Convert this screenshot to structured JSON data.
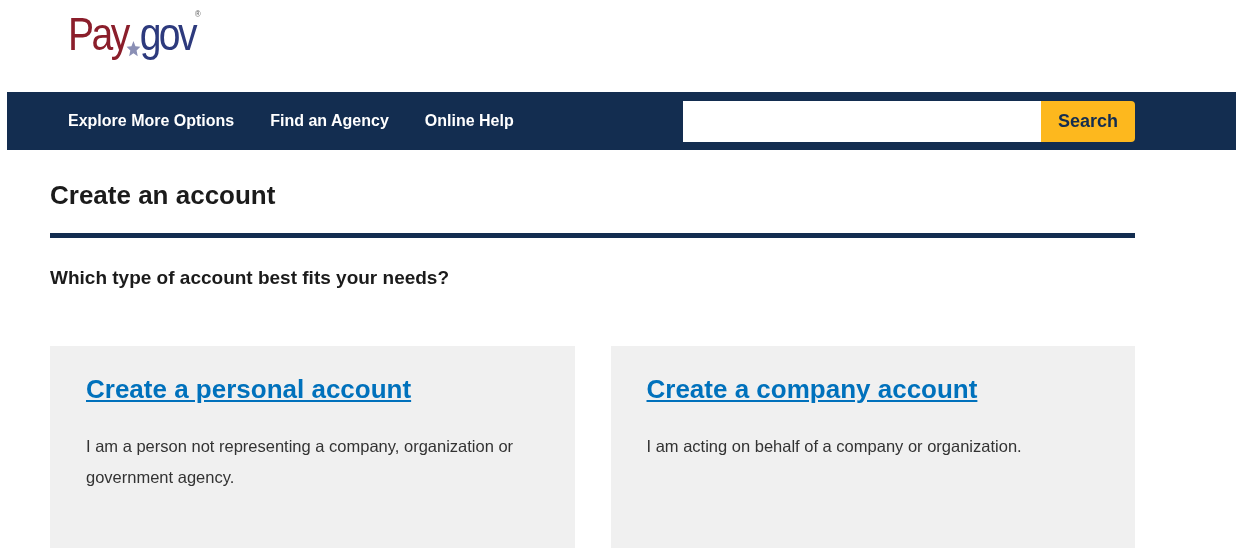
{
  "logo": {
    "part_1": "Pay",
    "part_2": "gov",
    "mark": "®"
  },
  "nav": {
    "items": [
      {
        "label": "Explore More Options"
      },
      {
        "label": "Find an Agency"
      },
      {
        "label": "Online Help"
      }
    ],
    "search": {
      "button": "Search"
    }
  },
  "page": {
    "title": "Create an account",
    "question": "Which type of account best fits your needs?",
    "cards": [
      {
        "link": "Create a personal account",
        "description": "I am a person not representing a company, organization or government agency."
      },
      {
        "link": "Create a company account",
        "description": "I am acting on behalf of a company or organization."
      }
    ]
  }
}
